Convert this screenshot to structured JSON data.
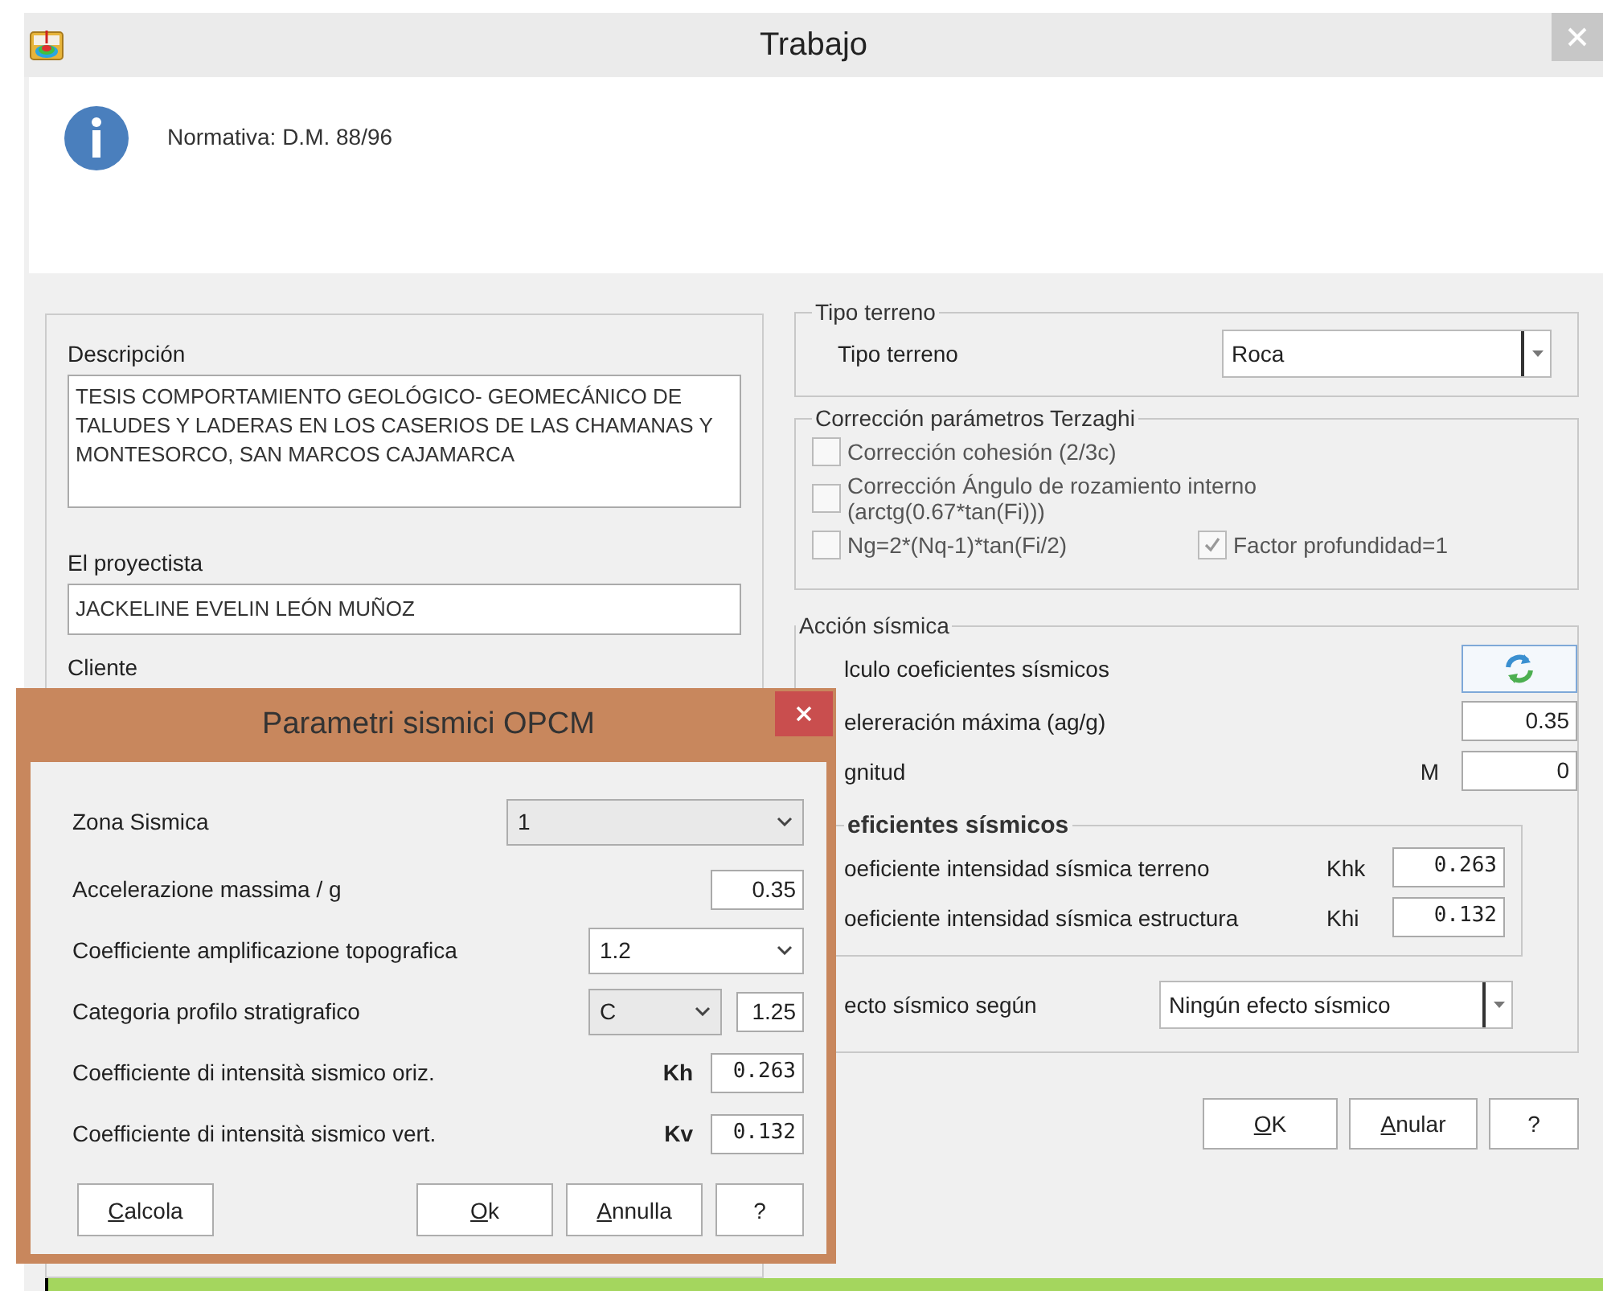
{
  "window": {
    "title": "Trabajo"
  },
  "info": {
    "text": "Normativa: D.M. 88/96"
  },
  "project": {
    "description_label": "Descripción",
    "description": "TESIS COMPORTAMIENTO GEOLÓGICO- GEOMECÁNICO DE TALUDES Y LADERAS EN LOS CASERIOS DE LAS CHAMANAS Y MONTESORCO, SAN MARCOS CAJAMARCA",
    "designer_label": "El proyectista",
    "designer": "JACKELINE EVELIN LEÓN MUÑOZ",
    "client_label": "Cliente"
  },
  "terrain_group": {
    "title": "Tipo terreno",
    "label": "Tipo terreno",
    "value": "Roca"
  },
  "terzaghi_group": {
    "title": "Corrección parámetros Terzaghi",
    "options": [
      {
        "label": "Corrección cohesión (2/3c)",
        "checked": false
      },
      {
        "label": "Corrección Ángulo de rozamiento interno (arctg(0.67*tan(Fi)))",
        "checked": false
      },
      {
        "label": "Ng=2*(Nq-1)*tan(Fi/2)",
        "checked": false
      },
      {
        "label": "Factor profundidad=1",
        "checked": true
      }
    ]
  },
  "seismic_group": {
    "title": "Acción sísmica",
    "calc_label": "lculo coeficientes sísmicos",
    "accel_label": "elereración máxima (ag/g)",
    "accel": "0.35",
    "magnitude_label": "gnitud",
    "magnitude_symbol": "M",
    "magnitude": "0",
    "coefficients": {
      "title": "eficientes sísmicos",
      "rows": [
        {
          "label": "oeficiente intensidad sísmica terreno",
          "symbol": "Khk",
          "value": "0.263"
        },
        {
          "label": "oeficiente intensidad sísmica estructura",
          "symbol": "Khi",
          "value": "0.132"
        }
      ]
    },
    "effect_label": "ecto sísmico según",
    "effect": "Ningún efecto sísmico"
  },
  "buttons": [
    {
      "label": "OK",
      "underline": true
    },
    {
      "label": "Anular",
      "underline": true
    },
    {
      "label": "?",
      "underline": false
    }
  ],
  "dialog": {
    "title": "Parametri sismici OPCM",
    "rows": [
      {
        "kind": "select",
        "label": "Zona Sismica",
        "value": "1"
      },
      {
        "kind": "input",
        "label": "Accelerazione massima / g",
        "value": "0.35"
      },
      {
        "kind": "select",
        "label": "Coefficiente amplificazione topografica",
        "value": "1.2"
      },
      {
        "kind": "select-input",
        "label": "Categoria profilo stratigrafico",
        "value": "C",
        "value_2": "1.25"
      },
      {
        "kind": "input",
        "label": "Coefficiente di intensità sismico oriz.",
        "symbol": "Kh",
        "value": "0.263"
      },
      {
        "kind": "input",
        "label": "Coefficiente di intensità sismico vert.",
        "symbol": "Kv",
        "value": "0.132"
      }
    ],
    "buttons": [
      {
        "label": "Calcola",
        "underline": true
      },
      {
        "label": "Ok",
        "underline": true
      },
      {
        "label": "Annulla",
        "underline": true
      },
      {
        "label": "?",
        "underline": false
      }
    ]
  }
}
